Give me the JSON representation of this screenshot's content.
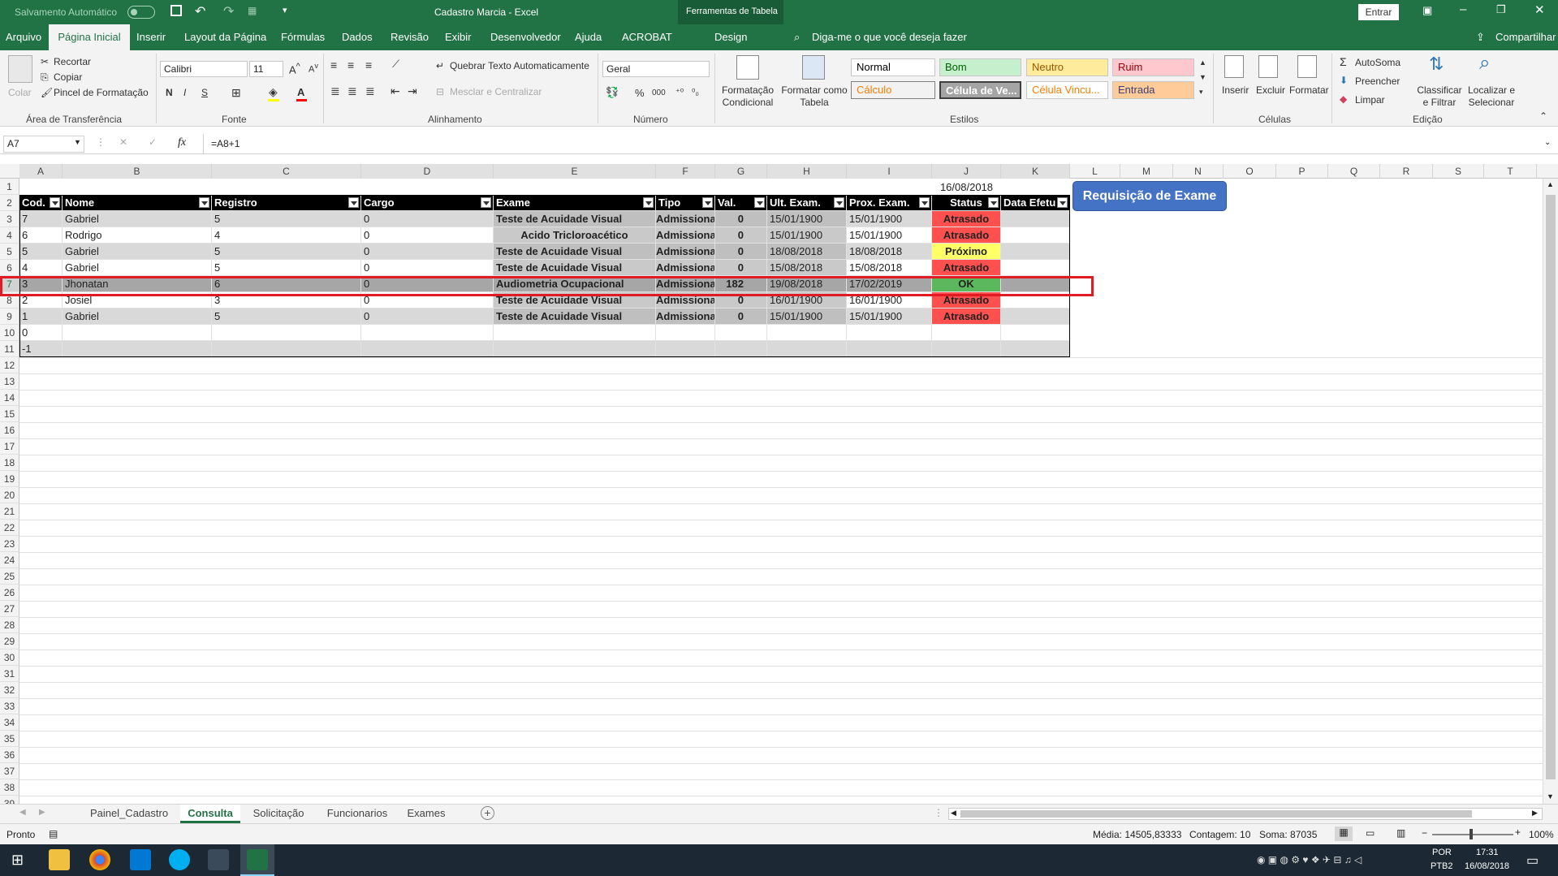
{
  "titlebar": {
    "autosave": "Salvamento Automático",
    "title": "Cadastro Marcia  -  Excel",
    "context_tab": "Ferramentas de Tabela",
    "signin": "Entrar"
  },
  "tabs": [
    "Arquivo",
    "Página Inicial",
    "Inserir",
    "Layout da Página",
    "Fórmulas",
    "Dados",
    "Revisão",
    "Exibir",
    "Desenvolvedor",
    "Ajuda",
    "ACROBAT",
    "Design"
  ],
  "tell_me": "Diga-me o que você deseja fazer",
  "share": "Compartilhar",
  "clipboard": {
    "paste": "Colar",
    "cut": "Recortar",
    "copy": "Copiar",
    "painter": "Pincel de Formatação",
    "label": "Área de Transferência"
  },
  "font": {
    "name": "Calibri",
    "size": "11",
    "bold": "N",
    "italic": "I",
    "underline": "S",
    "label": "Fonte"
  },
  "alignment": {
    "wrap": "Quebrar Texto Automaticamente",
    "merge": "Mesclar e Centralizar",
    "label": "Alinhamento"
  },
  "number": {
    "format": "Geral",
    "label": "Número",
    "pct": "%",
    "thousands": "000"
  },
  "styles_group": {
    "cond": "Formatação Condicional",
    "table": "Formatar como Tabela",
    "label": "Estilos",
    "items": [
      "Normal",
      "Bom",
      "Neutro",
      "Ruim",
      "Cálculo",
      "Célula de Ve...",
      "Célula Vincu...",
      "Entrada"
    ]
  },
  "cells_group": {
    "insert": "Inserir",
    "delete": "Excluir",
    "format": "Formatar",
    "label": "Células"
  },
  "editing": {
    "autosum": "AutoSoma",
    "fill": "Preencher",
    "clear": "Limpar",
    "sort": "Classificar e Filtrar",
    "find": "Localizar e Selecionar",
    "label": "Edição"
  },
  "formula_bar": {
    "name_box": "A7",
    "fx": "fx",
    "formula": "=A8+1"
  },
  "columns": [
    "A",
    "B",
    "C",
    "D",
    "E",
    "F",
    "G",
    "H",
    "I",
    "J",
    "K",
    "L",
    "M",
    "N",
    "O",
    "P",
    "Q",
    "R",
    "S",
    "T"
  ],
  "date_cell": "16/08/2018",
  "button": "Requisição de Exame",
  "headers": [
    "Cod.",
    "Nome",
    "Registro",
    "Cargo",
    "Exame",
    "Tipo",
    "Val.",
    "Ult. Exam.",
    "Prox. Exam.",
    "Status",
    "Data Efetu"
  ],
  "rows": [
    [
      "7",
      "Gabriel",
      "5",
      "0",
      "Teste de Acuidade Visual",
      "Admissional",
      "0",
      "15/01/1900",
      "15/01/1900",
      "Atrasado",
      ""
    ],
    [
      "6",
      "Rodrigo",
      "4",
      "0",
      "Acido Tricloroacético",
      "Admissional",
      "0",
      "15/01/1900",
      "15/01/1900",
      "Atrasado",
      ""
    ],
    [
      "5",
      "Gabriel",
      "5",
      "0",
      "Teste de Acuidade Visual",
      "Admissional",
      "0",
      "18/08/2018",
      "18/08/2018",
      "Próximo",
      ""
    ],
    [
      "4",
      "Gabriel",
      "5",
      "0",
      "Teste de Acuidade Visual",
      "Admissional",
      "0",
      "15/08/2018",
      "15/08/2018",
      "Atrasado",
      ""
    ],
    [
      "3",
      "Jhonatan",
      "6",
      "0",
      "Audiometria Ocupacional",
      "Admissional",
      "182",
      "19/08/2018",
      "17/02/2019",
      "OK",
      ""
    ],
    [
      "2",
      "Josiel",
      "3",
      "0",
      "Teste de Acuidade Visual",
      "Admissional",
      "0",
      "16/01/1900",
      "16/01/1900",
      "Atrasado",
      ""
    ],
    [
      "1",
      "Gabriel",
      "5",
      "0",
      "Teste de Acuidade Visual",
      "Admissional",
      "0",
      "15/01/1900",
      "15/01/1900",
      "Atrasado",
      ""
    ],
    [
      "0",
      "",
      "",
      "",
      "",
      "",
      "",
      "",
      "",
      "",
      ""
    ],
    [
      "-1",
      "",
      "",
      "",
      "",
      "",
      "",
      "",
      "",
      "",
      ""
    ]
  ],
  "status_colors": {
    "Atrasado": "#ff5050",
    "Próximo": "#ffff66",
    "OK": "#5cb85c"
  },
  "sheets": [
    "Painel_Cadastro",
    "Consulta",
    "Solicitação",
    "Funcionarios",
    "Exames"
  ],
  "statusbar": {
    "ready": "Pronto",
    "avg": "Média: 14505,83333",
    "count": "Contagem: 10",
    "sum": "Soma: 87035",
    "zoom": "100%"
  },
  "taskbar": {
    "lang1": "POR",
    "lang2": "PTB2",
    "time": "17:31",
    "date": "16/08/2018"
  },
  "accent": "#217346"
}
